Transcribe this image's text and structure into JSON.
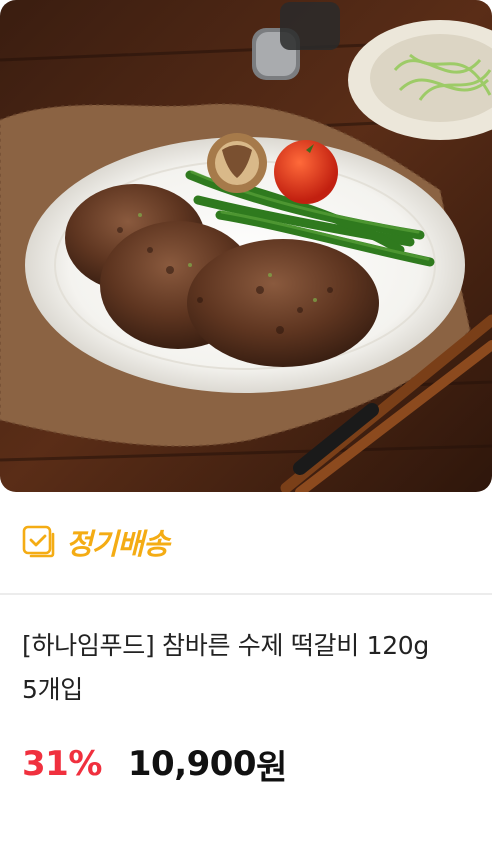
{
  "product": {
    "image_alt": "떡갈비",
    "badge": {
      "icon": "calendar-check-icon",
      "label": "정기배송",
      "color": "#f4ac14"
    },
    "title": "[하나임푸드] 참바른 수제 떡갈비 120g 5개입",
    "discount": "31%",
    "price": "10,900",
    "currency": "원",
    "colors": {
      "discount": "#f0303e",
      "price": "#111111"
    }
  }
}
